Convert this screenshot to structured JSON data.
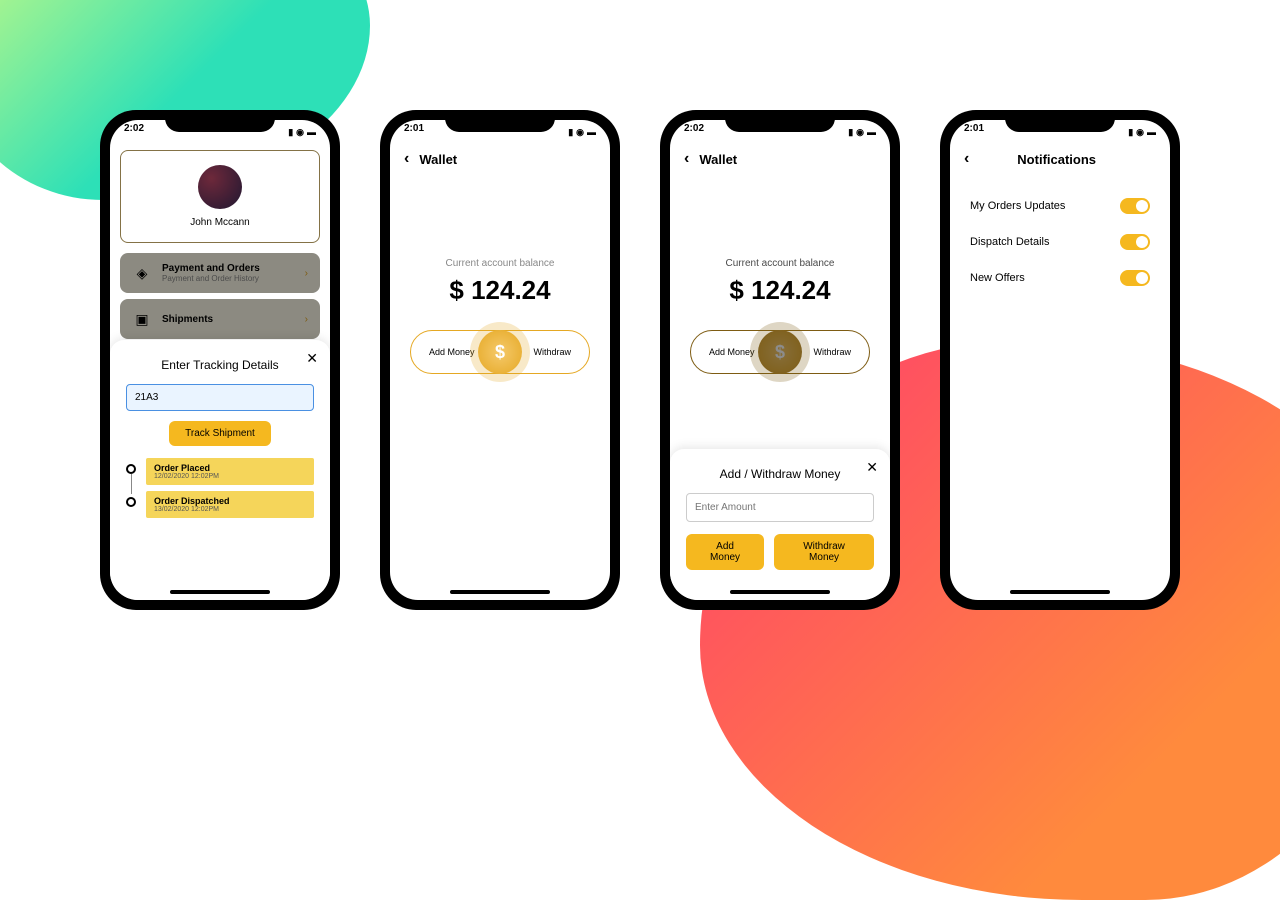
{
  "status": {
    "time1": "2:02",
    "time2": "2:01"
  },
  "phone1": {
    "profile_name": "John Mccann",
    "menu": {
      "payments_t": "Payment and Orders",
      "payments_s": "Payment and Order History",
      "shipments_t": "Shipments"
    },
    "sheet": {
      "title": "Enter Tracking Details",
      "input_value": "21A3",
      "track_btn": "Track Shipment",
      "timeline": [
        {
          "title": "Order Placed",
          "date": "12/02/2020 12:02PM"
        },
        {
          "title": "Order Dispatched",
          "date": "13/02/2020 12:02PM"
        }
      ]
    }
  },
  "wallet": {
    "title": "Wallet",
    "balance_label": "Current account balance",
    "balance": "$ 124.24",
    "add_label": "Add Money",
    "withdraw_label": "Withdraw"
  },
  "phone3_sheet": {
    "title": "Add / Withdraw Money",
    "placeholder": "Enter Amount",
    "add_btn": "Add Money",
    "withdraw_btn": "Withdraw Money"
  },
  "notifications": {
    "title": "Notifications",
    "items": [
      "My Orders Updates",
      "Dispatch Details",
      "New Offers"
    ]
  }
}
